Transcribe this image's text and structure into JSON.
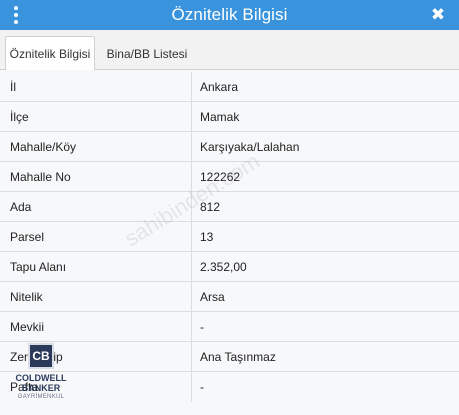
{
  "window": {
    "title": "Öznitelik Bilgisi",
    "close_label": "✖"
  },
  "tabs": [
    {
      "label": "Öznitelik Bilgisi",
      "active": true
    },
    {
      "label": "Bina/BB Listesi",
      "active": false
    }
  ],
  "rows": [
    {
      "label": "İl",
      "value": "Ankara"
    },
    {
      "label": "İlçe",
      "value": "Mamak"
    },
    {
      "label": "Mahalle/Köy",
      "value": "Karşıyaka/Lalahan"
    },
    {
      "label": "Mahalle No",
      "value": "122262"
    },
    {
      "label": "Ada",
      "value": "812"
    },
    {
      "label": "Parsel",
      "value": "13"
    },
    {
      "label": "Tapu Alanı",
      "value": "2.352,00"
    },
    {
      "label": "Nitelik",
      "value": "Arsa"
    },
    {
      "label": "Mevkii",
      "value": "-"
    },
    {
      "label": "Zemin Tip",
      "value": "Ana Taşınmaz"
    },
    {
      "label": "Pafta",
      "value": "-"
    }
  ],
  "watermark": {
    "text": "sahibinden.com"
  },
  "logo": {
    "mark": "CB",
    "line1": "COLDWELL",
    "line2": "BANKER",
    "line3": "GAYRİMENKUL"
  },
  "colors": {
    "titlebar": "#3a93dd",
    "tab_background": "#f2f2f2",
    "table_background": "#f7f8fa",
    "brand": "#2b3a5b"
  }
}
